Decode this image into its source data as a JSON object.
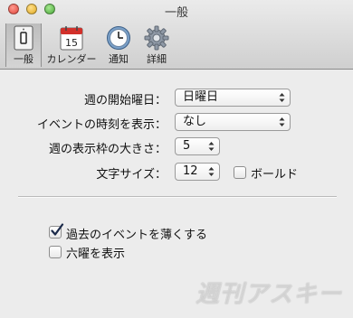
{
  "window": {
    "title": "一般"
  },
  "toolbar": {
    "items": [
      {
        "label": "一般",
        "icon": "general-switch-icon",
        "selected": true
      },
      {
        "label": "カレンダー",
        "icon": "calendar-icon",
        "day": "15"
      },
      {
        "label": "通知",
        "icon": "clock-icon"
      },
      {
        "label": "詳細",
        "icon": "gear-icon"
      }
    ]
  },
  "settings": {
    "week_start": {
      "label": "週の開始曜日：",
      "value": "日曜日"
    },
    "event_time": {
      "label": "イベントの時刻を表示：",
      "value": "なし"
    },
    "week_size": {
      "label": "週の表示枠の大きさ：",
      "value": "5"
    },
    "font_size": {
      "label": "文字サイズ：",
      "value": "12"
    },
    "bold": {
      "label": "ボールド",
      "checked": false
    },
    "fade_past": {
      "label": "過去のイベントを薄くする",
      "checked": true
    },
    "rokuyo": {
      "label": "六曜を表示",
      "checked": false
    }
  },
  "watermark": {
    "text": "週刊アスキー"
  },
  "colors": {
    "accent": "#3f82d8",
    "check": "#1b2a4a"
  }
}
